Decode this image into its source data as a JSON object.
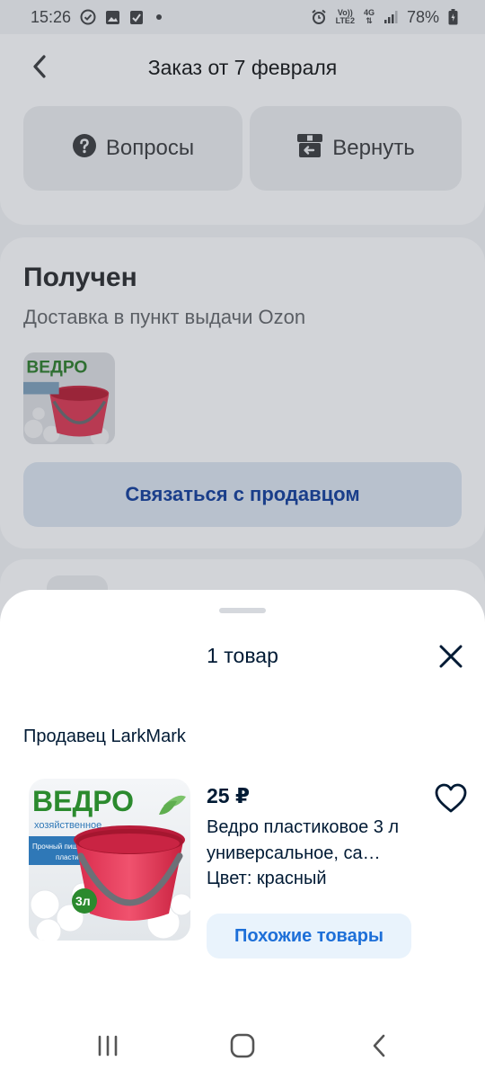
{
  "status_bar": {
    "time": "15:26",
    "net_top": "Vo))",
    "net_bottom": "LTE2",
    "network": "4G",
    "battery": "78%"
  },
  "header": {
    "title": "Заказ от 7 февраля",
    "questions_label": "Вопросы",
    "return_label": "Вернуть"
  },
  "order": {
    "status": "Получен",
    "delivery": "Доставка в пункт выдачи Ozon",
    "contact_seller_label": "Связаться с продавцом",
    "thumb_text": "ВЕДРО"
  },
  "sheet": {
    "title": "1 товар",
    "seller": "Продавец LarkMark",
    "product": {
      "price": "25 ₽",
      "name": "Ведро пластиковое 3 л универсальное, са…",
      "color": "Цвет: красный",
      "similar_label": "Похожие товары",
      "image_title": "ВЕДРО",
      "image_subtitle": "хозяйственное",
      "image_badge_line1": "Прочный пищевой",
      "image_badge_line2": "пластик",
      "image_volume": "3л"
    }
  },
  "icons": {
    "back": "chevron-left-icon",
    "questions": "question-circle-icon",
    "return": "return-box-icon",
    "close": "close-icon",
    "favorite": "heart-outline-icon",
    "nav_recent": "recent-apps-icon",
    "nav_home": "home-icon",
    "nav_back": "back-icon"
  },
  "colors": {
    "accent": "#1d6fd8",
    "text": "#001a34",
    "bucket": "#e43a5a",
    "brand_green": "#2b8a2e"
  }
}
